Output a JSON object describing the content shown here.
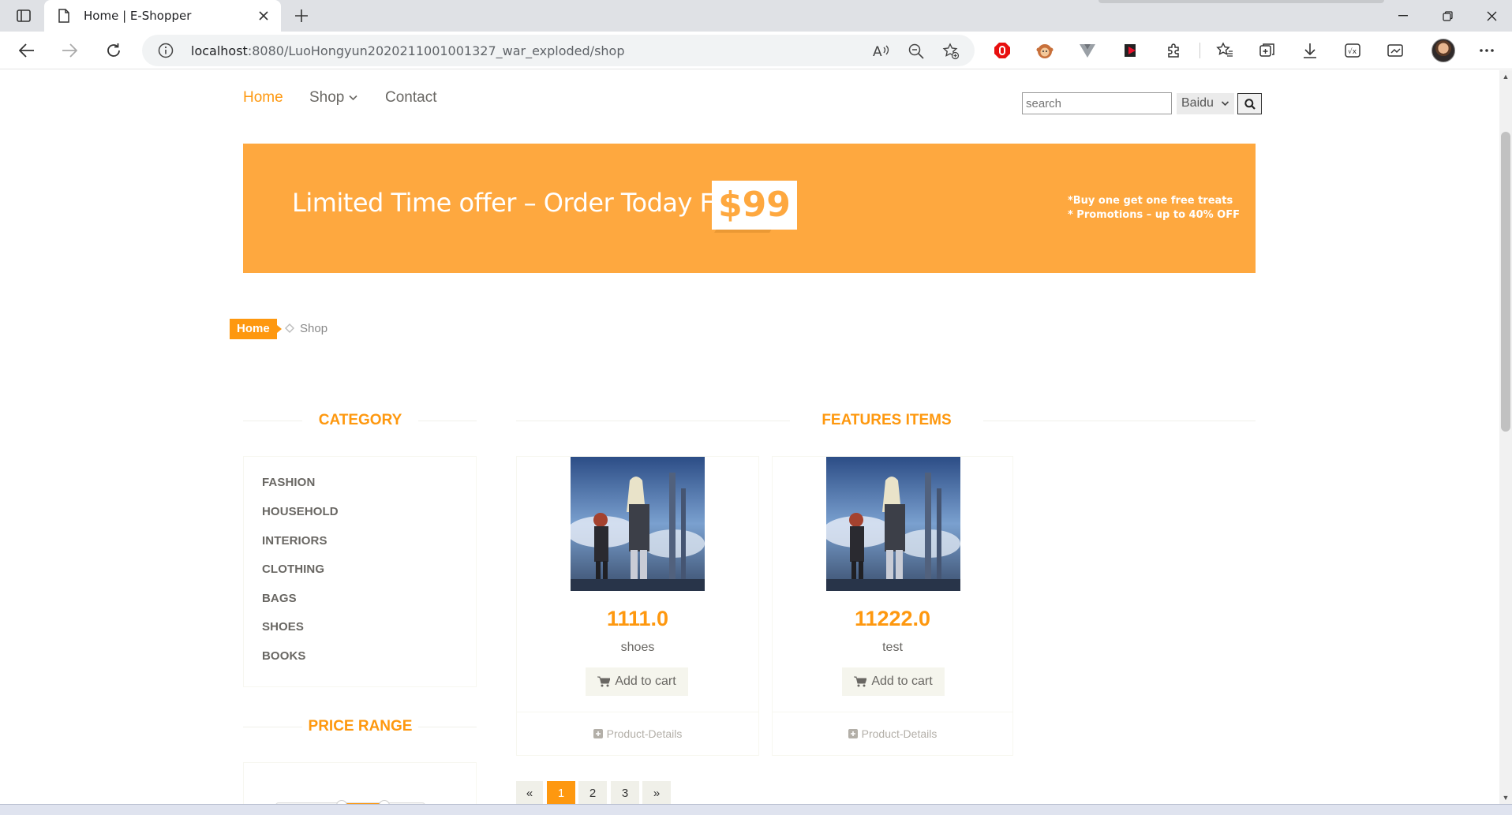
{
  "browser": {
    "tab_title": "Home | E-Shopper",
    "url_host": "localhost",
    "url_rest": ":8080/LuoHongyun2020211001001327_war_exploded/shop"
  },
  "site_nav": {
    "home": "Home",
    "shop": "Shop",
    "contact": "Contact"
  },
  "search": {
    "placeholder": "search",
    "engine": "Baidu"
  },
  "banner": {
    "headline": "Limited Time offer – Order Today For",
    "price": "$99",
    "promo_line1": "*Buy one get one free treats",
    "promo_line2": "* Promotions – up to 40% OFF"
  },
  "breadcrumb": {
    "home": "Home",
    "current": "Shop"
  },
  "sidebar": {
    "category_title": "CATEGORY",
    "categories": [
      "FASHION",
      "HOUSEHOLD",
      "INTERIORS",
      "CLOTHING",
      "BAGS",
      "SHOES",
      "BOOKS"
    ],
    "price_range_title": "PRICE RANGE"
  },
  "features": {
    "title": "FEATURES ITEMS",
    "products": [
      {
        "price": "1111.0",
        "name": "shoes",
        "cart_label": "Add to cart",
        "details_label": "Product-Details"
      },
      {
        "price": "11222.0",
        "name": "test",
        "cart_label": "Add to cart",
        "details_label": "Product-Details"
      }
    ]
  },
  "pagination": {
    "prev": "«",
    "pages": [
      "1",
      "2",
      "3"
    ],
    "next": "»",
    "active_page": "1"
  },
  "colors": {
    "accent": "#fe980f",
    "banner": "#fea83f",
    "text": "#696763"
  }
}
